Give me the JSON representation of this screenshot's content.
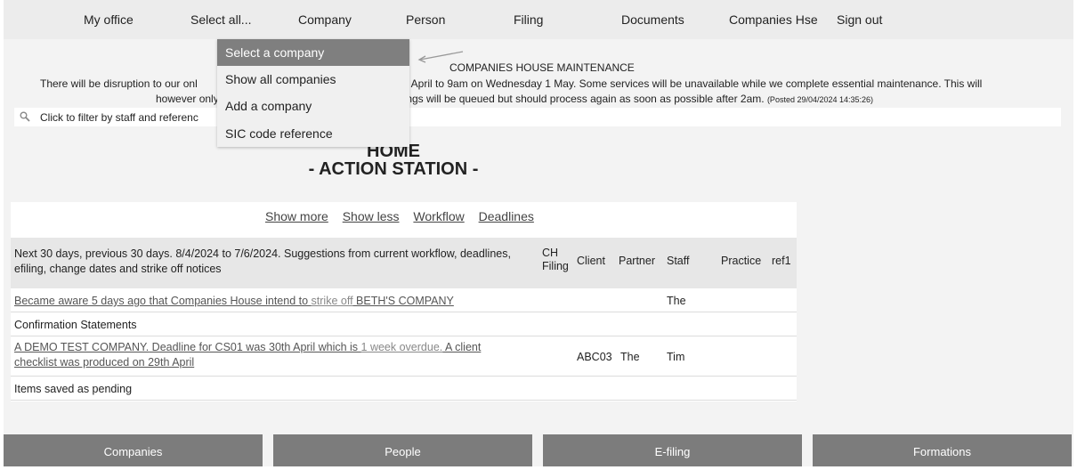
{
  "nav": {
    "items": [
      "My office",
      "Select all...",
      "Company",
      "Person",
      "Filing",
      "Documents",
      "Companies Hse",
      "Sign out"
    ]
  },
  "dropdown": {
    "items": [
      "Select a company",
      "Show all companies",
      "Add a company",
      "SIC code reference"
    ],
    "selected": "Select a company"
  },
  "maintenance": {
    "title": "COMPANIES HOUSE MAINTENANCE",
    "line1_a": "There will be disruption to our onl",
    "line1_b": ") April to 9am on Wednesday 1 May. Some services will be unavailable while we complete essential maintenance. This will",
    "line2_a": "however only a",
    "line2_b": "filings will be queued but should process again as soon as possible after 2am.",
    "posted": "(Posted 29/04/2024 14:35:26)"
  },
  "filter": {
    "text": "Click to filter by staff and referenc"
  },
  "home": {
    "title": "HOME",
    "subtitle": "- ACTION STATION -"
  },
  "panel": {
    "links": [
      "Show more",
      "Show less",
      "Workflow",
      "Deadlines"
    ],
    "header": {
      "description": "Next 30 days, previous 30 days. 8/4/2024 to 7/6/2024. Suggestions from current workflow, deadlines, efiling, change dates and strike off notices",
      "ch_filing_1": "CH",
      "ch_filing_2": "Filing",
      "client": "Client",
      "partner": "Partner",
      "staff": "Staff",
      "practice": "Practice",
      "ref1": "ref1"
    },
    "rows": {
      "r1": {
        "text_a": "Became aware 5 days ago that Companies House intend to ",
        "text_b": "strike off",
        "text_c": " BETH'S COMPANY",
        "staff": "The"
      },
      "r2": {
        "text": "Confirmation Statements"
      },
      "r3": {
        "company": "A DEMO TEST COMPANY.",
        "deadline": " Deadline for CS01 was 30th April which is ",
        "overdue": "1 week overdue.",
        "rest_a": " A client",
        "rest_b": "checklist was produced on 29th April",
        "client": "ABC03",
        "partner": "The",
        "staff": "Tim"
      },
      "r4": {
        "text": "Items saved as pending"
      }
    }
  },
  "tabs": [
    "Companies",
    "People",
    "E-filing",
    "Formations"
  ]
}
